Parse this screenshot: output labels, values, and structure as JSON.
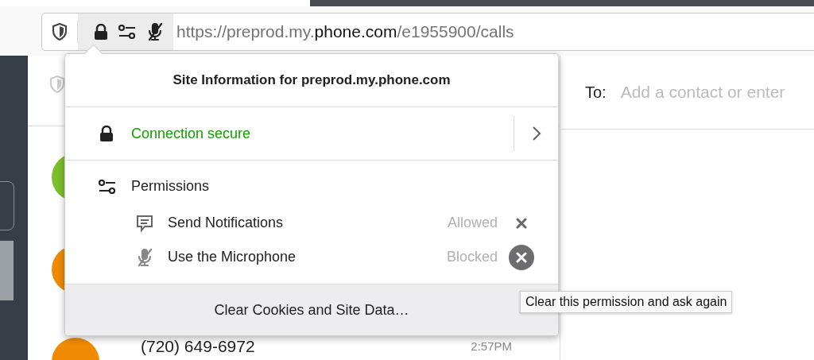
{
  "url": {
    "prefix": "https://preprod.my.",
    "domain": "phone.com",
    "path": "/e1955900/calls"
  },
  "popup": {
    "title": "Site Information for preprod.my.phone.com",
    "connection": "Connection secure",
    "permissions_heading": "Permissions",
    "permissions": [
      {
        "kind": "notifications",
        "label": "Send Notifications",
        "status": "Allowed",
        "blocked": false
      },
      {
        "kind": "microphone",
        "label": "Use the Microphone",
        "status": "Blocked",
        "blocked": true
      }
    ],
    "footer_button": "Clear Cookies and Site Data…"
  },
  "tooltip": "Clear this permission and ask again",
  "compose": {
    "to_label": "To:",
    "placeholder": "Add a contact or enter"
  },
  "calls": [
    {
      "color": "#7bbf2a"
    },
    {
      "color": "#f08a00"
    },
    {
      "number": "(720) 649-6972",
      "time": "2:57PM",
      "color": "#f08a00"
    }
  ]
}
